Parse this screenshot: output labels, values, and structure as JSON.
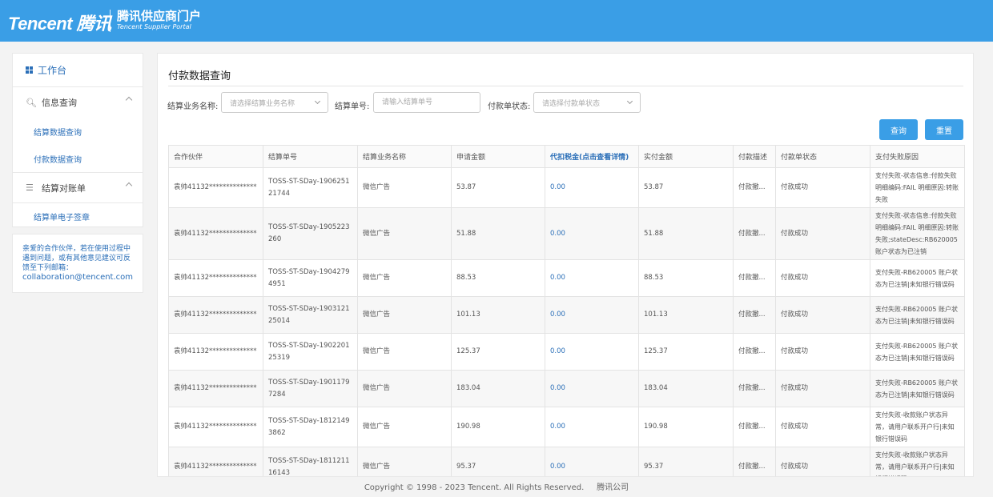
{
  "header": {
    "logo": "Tencent 腾讯",
    "portal_cn": "腾讯供应商门户",
    "portal_en": "Tencent Supplier Portal"
  },
  "sidebar": {
    "workbench": "工作台",
    "group1": "信息查询",
    "group1_items": [
      "结算数据查询",
      "付款数据查询"
    ],
    "group2": "结算对账单",
    "group2_items": [
      "结算单电子签章"
    ]
  },
  "notice": {
    "text": "亲爱的合作伙伴，若在使用过程中遇到问题，或有其他意见建议可反馈至下列邮箱：",
    "email": "collaboration@tencent.com"
  },
  "main": {
    "title": "付款数据查询",
    "filters": {
      "biz_label": "结算业务名称:",
      "biz_placeholder": "请选择结算业务名称",
      "no_label": "结算单号:",
      "no_placeholder": "请输入结算单号",
      "status_label": "付款单状态:",
      "status_placeholder": "请选择付款单状态"
    },
    "query_button": "查询",
    "reset_button": "重置"
  },
  "table": {
    "columns": [
      "合作伙伴",
      "结算单号",
      "结算业务名称",
      "申请金额",
      "代扣税金(点击查看详情)",
      "实付金额",
      "付款描述",
      "付款单状态",
      "支付失败原因"
    ],
    "rows": [
      [
        "袁帅41132**************",
        "TOSS-ST-SDay-190625121744",
        "微信广告",
        "53.87",
        "0.00",
        "53.87",
        "付款撤...",
        "付款成功",
        "支付失败-状态信息:付款失败 明细编码:FAIL 明细原因:转账失败"
      ],
      [
        "袁帅41132**************",
        "TOSS-ST-SDay-1905223260",
        "微信广告",
        "51.88",
        "0.00",
        "51.88",
        "付款撤...",
        "付款成功",
        "支付失败-状态信息:付款失败 明细编码:FAIL 明细原因:转账失败;stateDesc:RB620005 账户状态为已注销"
      ],
      [
        "袁帅41132**************",
        "TOSS-ST-SDay-19042794951",
        "微信广告",
        "88.53",
        "0.00",
        "88.53",
        "付款撤...",
        "付款成功",
        "支付失败-RB620005 账户状态为已注销|未知银行错误码"
      ],
      [
        "袁帅41132**************",
        "TOSS-ST-SDay-190312125014",
        "微信广告",
        "101.13",
        "0.00",
        "101.13",
        "付款撤...",
        "付款成功",
        "支付失败-RB620005 账户状态为已注销|未知银行错误码"
      ],
      [
        "袁帅41132**************",
        "TOSS-ST-SDay-190220125319",
        "微信广告",
        "125.37",
        "0.00",
        "125.37",
        "付款撤...",
        "付款成功",
        "支付失败-RB620005 账户状态为已注销|未知银行错误码"
      ],
      [
        "袁帅41132**************",
        "TOSS-ST-SDay-19011797284",
        "微信广告",
        "183.04",
        "0.00",
        "183.04",
        "付款撤...",
        "付款成功",
        "支付失败-RB620005 账户状态为已注销|未知银行错误码"
      ],
      [
        "袁帅41132**************",
        "TOSS-ST-SDay-18121493862",
        "微信广告",
        "190.98",
        "0.00",
        "190.98",
        "付款撤...",
        "付款成功",
        "支付失败-收款账户状态异常，请用户联系开户行|未知银行错误码"
      ],
      [
        "袁帅41132**************",
        "TOSS-ST-SDay-181121116143",
        "微信广告",
        "95.37",
        "0.00",
        "95.37",
        "付款撤...",
        "付款成功",
        "支付失败-收款账户状态异常，请用户联系开户行|未知银行错误码"
      ]
    ]
  },
  "footer": {
    "copyright": "Copyright © 1998 - 2023 Tencent. All Rights Reserved.",
    "company": "腾讯公司"
  },
  "colors": {
    "brand": "#3a9ee6",
    "link": "#2b6fb8"
  }
}
